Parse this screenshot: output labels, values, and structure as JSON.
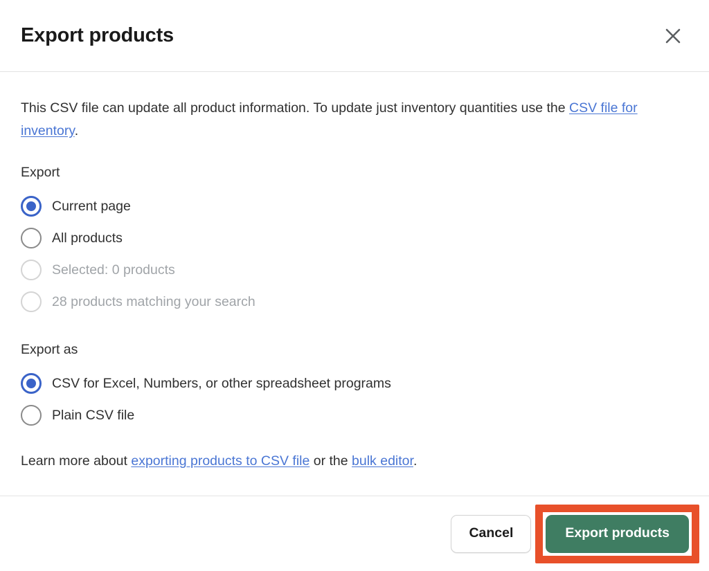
{
  "dialog": {
    "title": "Export products",
    "close_icon": "close-icon"
  },
  "intro": {
    "before_link": "This CSV file can update all product information. To update just inventory quantities use the ",
    "link_text": "CSV file for inventory",
    "after_link": "."
  },
  "export_group": {
    "label": "Export",
    "options": [
      {
        "label": "Current page",
        "selected": true,
        "disabled": false
      },
      {
        "label": "All products",
        "selected": false,
        "disabled": false
      },
      {
        "label": "Selected: 0 products",
        "selected": false,
        "disabled": true
      },
      {
        "label": "28 products matching your search",
        "selected": false,
        "disabled": true
      }
    ]
  },
  "export_as_group": {
    "label": "Export as",
    "options": [
      {
        "label": "CSV for Excel, Numbers, or other spreadsheet programs",
        "selected": true,
        "disabled": false
      },
      {
        "label": "Plain CSV file",
        "selected": false,
        "disabled": false
      }
    ]
  },
  "learn_more": {
    "prefix": "Learn more about ",
    "link1": "exporting products to CSV file",
    "middle": " or the ",
    "link2": "bulk editor",
    "suffix": "."
  },
  "footer": {
    "cancel_label": "Cancel",
    "export_label": "Export products"
  },
  "colors": {
    "accent_link": "#4a76d4",
    "radio_selected": "#3a63c8",
    "primary_button": "#3f7d62",
    "highlight_annotation": "#e8502a",
    "text": "#303030",
    "text_disabled": "#a0a4a8",
    "divider": "#e3e3e3"
  }
}
